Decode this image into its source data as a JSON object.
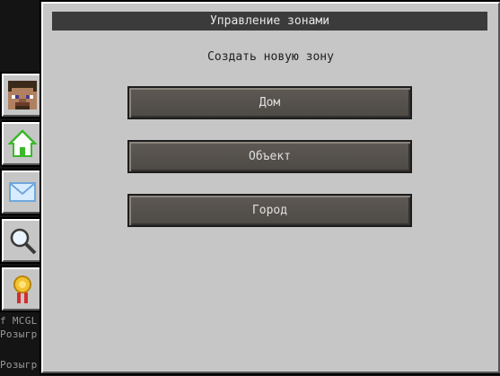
{
  "background": {
    "chat_lines": [
      "f MCGL",
      "Розыгр",
      "Розыгр"
    ]
  },
  "panel": {
    "title": "Управление зонами",
    "subtitle": "Создать новую зону",
    "buttons": [
      {
        "label": "Дом"
      },
      {
        "label": "Объект"
      },
      {
        "label": "Город"
      }
    ]
  },
  "tabs": [
    {
      "icon": "player-head-icon",
      "active": false
    },
    {
      "icon": "house-icon",
      "active": true
    },
    {
      "icon": "envelope-icon",
      "active": false
    },
    {
      "icon": "magnifier-icon",
      "active": false
    },
    {
      "icon": "medal-icon",
      "active": false
    }
  ],
  "colors": {
    "panel_bg": "#c6c6c6",
    "title_bar": "#3b3b3b",
    "button": "#57524d",
    "house_green": "#4cd137"
  }
}
